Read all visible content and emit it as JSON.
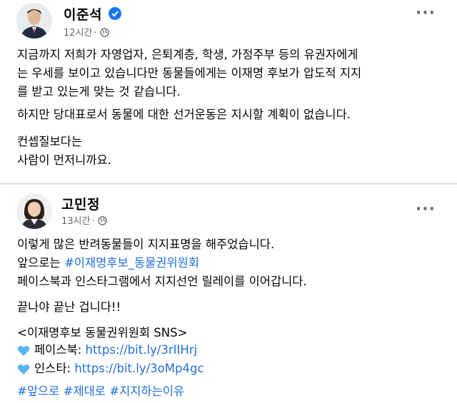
{
  "post1": {
    "author": "이준석",
    "time": "12시간",
    "paragraph1": "지금까지 저희가 자영업자, 은퇴계층, 학생, 가정주부 등의 유권자에게\n는 우세를 보이고 있습니다만 동물들에게는 이재명 후보가 압도적 지지\n를 받고 있는게 맞는 것 같습니다.",
    "paragraph2": "하지만 당대표로서 동물에 대한 선거운동은 지시할 계획이 없습니다.",
    "paragraph3": "컨셉질보다는\n사람이 먼저니까요."
  },
  "post2": {
    "author": "고민정",
    "time": "13시간",
    "line1": "이렇게 많은 반려동물들이 지지표명을 해주었습니다.",
    "line2_prefix": "앞으로는 ",
    "line2_hashtag": "#이재명후보_동물권위원회",
    "line3": "페이스북과 인스타그램에서 지지선언 릴레이를 이어갑니다.",
    "line4": "끝나야 끝난 겁니다!!",
    "line5": "<이재명후보 동물권위원회 SNS>",
    "facebook_label": "페이스북: ",
    "facebook_url": "https://bit.ly/3rIIHrj",
    "instagram_label": "인스타: ",
    "instagram_url": "https://bit.ly/3oMp4gc",
    "hashtags": [
      "#앞으로",
      "#제대로",
      "#지지하는이유"
    ]
  },
  "ui": {
    "dot": "·",
    "more": "···"
  },
  "colors": {
    "link": "#216fdb",
    "verified": "#1877f2",
    "meta": "#65676b",
    "heart": "#5ab4ec"
  }
}
